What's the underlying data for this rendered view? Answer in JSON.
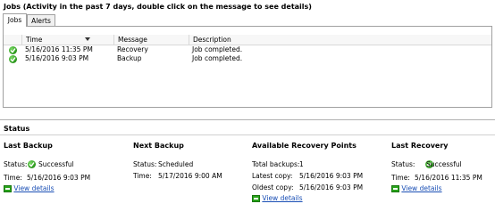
{
  "jobs": {
    "title": "Jobs (Activity in the past 7 days, double click on the message to see details)",
    "tabs": [
      "Jobs",
      "Alerts"
    ],
    "columns": [
      "Time",
      "Message",
      "Description"
    ],
    "rows": [
      {
        "status_icon": "success-check-icon",
        "time": "5/16/2016 11:35 PM",
        "message": "Recovery",
        "description": "Job completed."
      },
      {
        "status_icon": "success-check-icon",
        "time": "5/16/2016 9:03 PM",
        "message": "Backup",
        "description": "Job completed."
      }
    ]
  },
  "status": {
    "title": "Status",
    "last_backup": {
      "title": "Last Backup",
      "status_label": "Status:",
      "status_value": "Successful",
      "time_label": "Time:",
      "time_value": "5/16/2016 9:03 PM",
      "link": "View details"
    },
    "next_backup": {
      "title": "Next Backup",
      "status_label": "Status:",
      "status_value": "Scheduled",
      "time_label": "Time:",
      "time_value": "5/17/2016 9:00 AM"
    },
    "recovery_points": {
      "title": "Available Recovery Points",
      "total_label": "Total backups:",
      "total_value": "1",
      "latest_label": "Latest copy:",
      "latest_value": "5/16/2016 9:03 PM",
      "oldest_label": "Oldest copy:",
      "oldest_value": "5/16/2016 9:03 PM",
      "link": "View details"
    },
    "last_recovery": {
      "title": "Last Recovery",
      "status_label": "Status:",
      "status_value": "Successful",
      "time_label": "Time:",
      "time_value": "5/16/2016 11:35 PM",
      "link": "View details"
    }
  },
  "colors": {
    "link": "#1a4fb5",
    "success": "#2e9e1e"
  }
}
